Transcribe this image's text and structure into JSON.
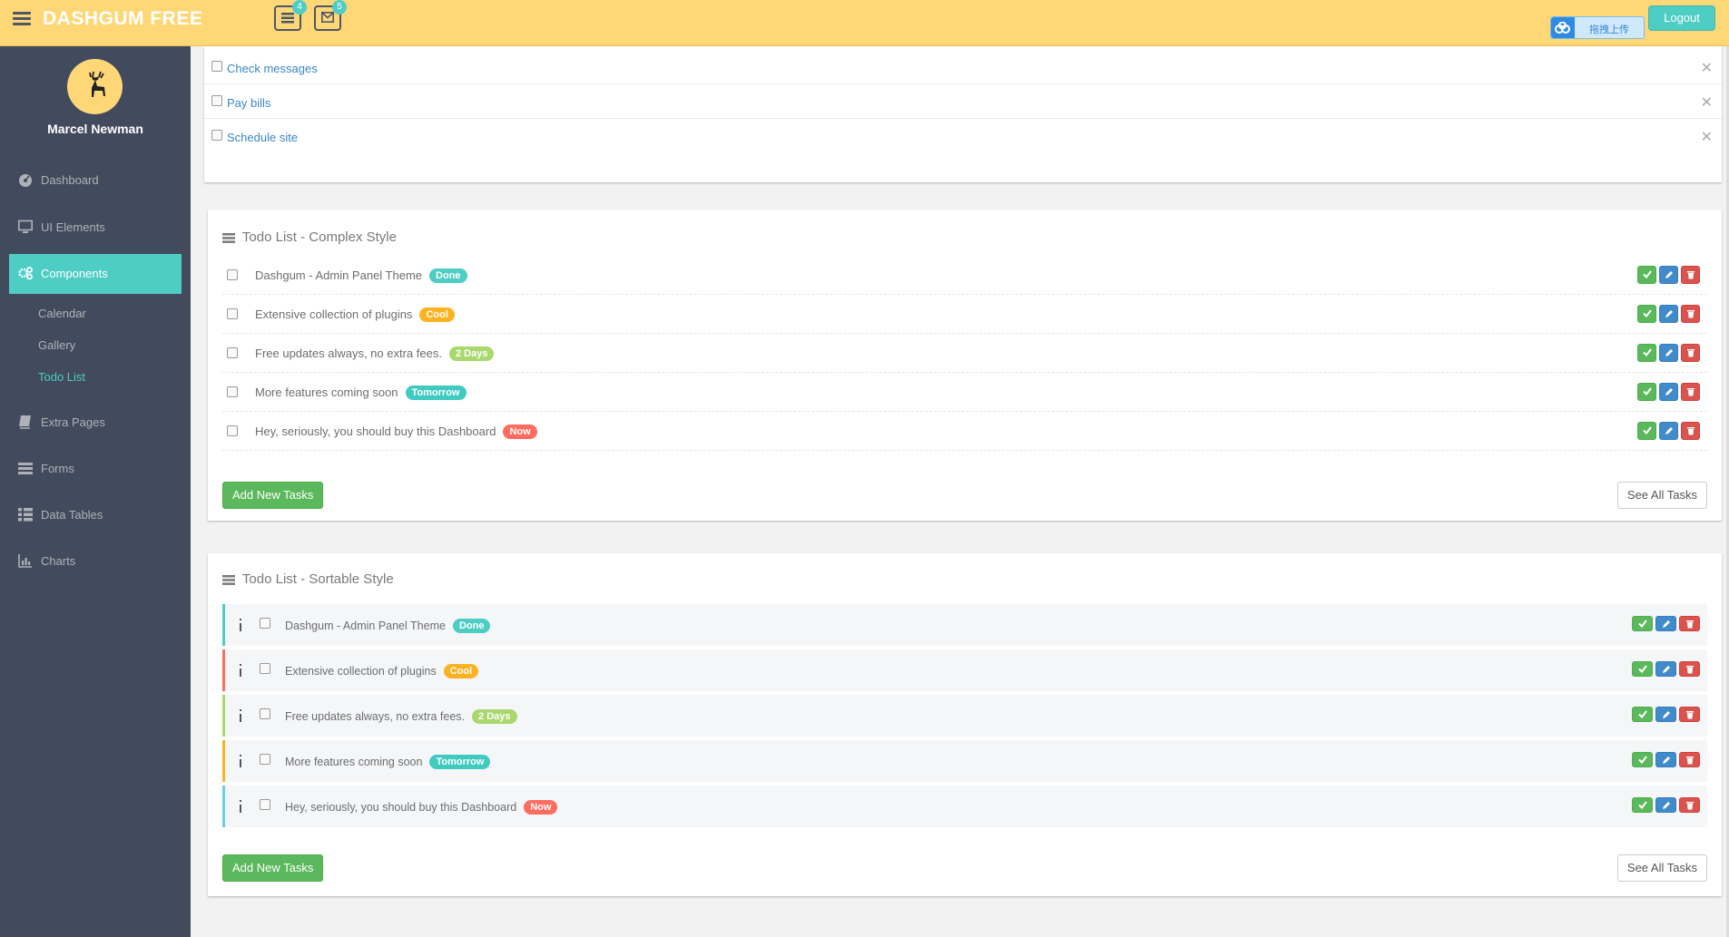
{
  "header": {
    "logo": "DASHGUM FREE",
    "tasks_badge": "4",
    "mail_badge": "5",
    "upload_label": "拖拽上传",
    "logout_label": "Logout"
  },
  "sidebar": {
    "username": "Marcel Newman",
    "items": [
      {
        "label": "Dashboard",
        "icon": "dashboard-icon"
      },
      {
        "label": "UI Elements",
        "icon": "desktop-icon"
      },
      {
        "label": "Components",
        "icon": "cogs-icon"
      },
      {
        "label": "Extra Pages",
        "icon": "book-icon"
      },
      {
        "label": "Forms",
        "icon": "tasks-icon"
      },
      {
        "label": "Data Tables",
        "icon": "th-icon"
      },
      {
        "label": "Charts",
        "icon": "bar-chart-icon"
      }
    ],
    "sub_items": [
      {
        "label": "Calendar"
      },
      {
        "label": "Gallery"
      },
      {
        "label": "Todo List"
      }
    ]
  },
  "simple_list": [
    {
      "text": "Check messages"
    },
    {
      "text": "Pay bills"
    },
    {
      "text": "Schedule site"
    }
  ],
  "complex": {
    "title": "Todo List - Complex Style",
    "tasks": [
      {
        "text": "Dashgum - Admin Panel Theme",
        "label": "Done",
        "color": "#4ecdc4"
      },
      {
        "text": "Extensive collection of plugins",
        "label": "Cool",
        "color": "#fcb322"
      },
      {
        "text": "Free updates always, no extra fees.",
        "label": "2 Days",
        "color": "#a9d86e"
      },
      {
        "text": "More features coming soon",
        "label": "Tomorrow",
        "color": "#41cac0"
      },
      {
        "text": "Hey, seriously, you should buy this Dashboard",
        "label": "Now",
        "color": "#ff6c60"
      }
    ],
    "add_label": "Add New Tasks",
    "see_all_label": "See All Tasks"
  },
  "sortable": {
    "title": "Todo List - Sortable Style",
    "tasks": [
      {
        "text": "Dashgum - Admin Panel Theme",
        "label": "Done",
        "color": "#4ecdc4",
        "border": "#4ecdc4"
      },
      {
        "text": "Extensive collection of plugins",
        "label": "Cool",
        "color": "#fcb322",
        "border": "#ff6c60"
      },
      {
        "text": "Free updates always, no extra fees.",
        "label": "2 Days",
        "color": "#a9d86e",
        "border": "#a9d86e"
      },
      {
        "text": "More features coming soon",
        "label": "Tomorrow",
        "color": "#41cac0",
        "border": "#fcb322"
      },
      {
        "text": "Hey, seriously, you should buy this Dashboard",
        "label": "Now",
        "color": "#ff6c60",
        "border": "#6ccde5"
      }
    ],
    "add_label": "Add New Tasks",
    "see_all_label": "See All Tasks"
  }
}
